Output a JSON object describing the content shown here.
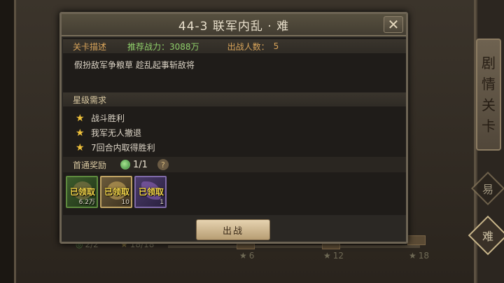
{
  "background": {
    "scroll_chars": [
      "剧",
      "情",
      "关",
      "卡"
    ],
    "badge_easy": "易",
    "badge_hard": "难",
    "jade_count": "2/2",
    "star_total": "18/18",
    "milestones": [
      "6",
      "12",
      "18"
    ]
  },
  "dialog": {
    "title": "44-3 联军内乱 · 难",
    "close_label": "✕",
    "info": {
      "stage_desc_label": "关卡描述",
      "power_label": "推荐战力：",
      "power_value": "3088万",
      "players_label": "出战人数：",
      "players_value": "5"
    },
    "description": "假扮敌军争粮草 趁乱起事斩敌将",
    "star_section_label": "星级需求",
    "requirements": [
      "战斗胜利",
      "我军无人撤退",
      "7回合内取得胜利"
    ],
    "reward_section": {
      "label": "首通奖励",
      "jade_count": "1/1",
      "help": "?"
    },
    "rewards": [
      {
        "status": "已领取",
        "qty": "6.2万"
      },
      {
        "status": "已领取",
        "qty": "10"
      },
      {
        "status": "已领取",
        "qty": "1"
      }
    ],
    "battle_button": "出战"
  },
  "colors": {
    "accent_gold": "#d8a45a",
    "accent_green": "#8fcf6a",
    "star": "#f0c23b",
    "claimed_text": "#f4d64a"
  }
}
